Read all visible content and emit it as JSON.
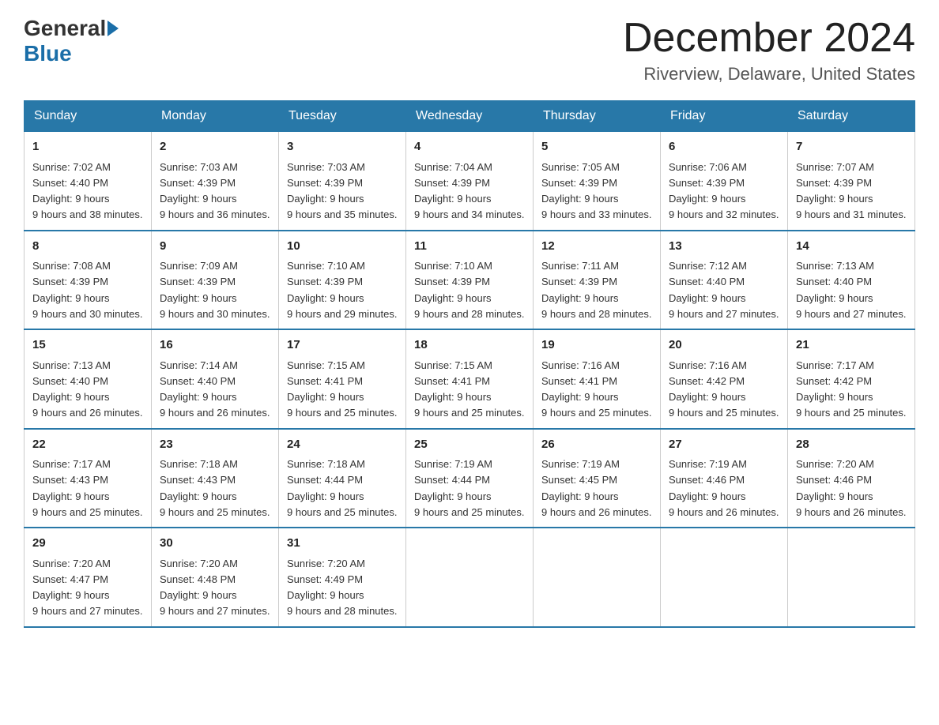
{
  "header": {
    "logo_general": "General",
    "logo_blue": "Blue",
    "month": "December 2024",
    "location": "Riverview, Delaware, United States"
  },
  "weekdays": [
    "Sunday",
    "Monday",
    "Tuesday",
    "Wednesday",
    "Thursday",
    "Friday",
    "Saturday"
  ],
  "weeks": [
    [
      {
        "day": "1",
        "sunrise": "7:02 AM",
        "sunset": "4:40 PM",
        "daylight": "9 hours and 38 minutes."
      },
      {
        "day": "2",
        "sunrise": "7:03 AM",
        "sunset": "4:39 PM",
        "daylight": "9 hours and 36 minutes."
      },
      {
        "day": "3",
        "sunrise": "7:03 AM",
        "sunset": "4:39 PM",
        "daylight": "9 hours and 35 minutes."
      },
      {
        "day": "4",
        "sunrise": "7:04 AM",
        "sunset": "4:39 PM",
        "daylight": "9 hours and 34 minutes."
      },
      {
        "day": "5",
        "sunrise": "7:05 AM",
        "sunset": "4:39 PM",
        "daylight": "9 hours and 33 minutes."
      },
      {
        "day": "6",
        "sunrise": "7:06 AM",
        "sunset": "4:39 PM",
        "daylight": "9 hours and 32 minutes."
      },
      {
        "day": "7",
        "sunrise": "7:07 AM",
        "sunset": "4:39 PM",
        "daylight": "9 hours and 31 minutes."
      }
    ],
    [
      {
        "day": "8",
        "sunrise": "7:08 AM",
        "sunset": "4:39 PM",
        "daylight": "9 hours and 30 minutes."
      },
      {
        "day": "9",
        "sunrise": "7:09 AM",
        "sunset": "4:39 PM",
        "daylight": "9 hours and 30 minutes."
      },
      {
        "day": "10",
        "sunrise": "7:10 AM",
        "sunset": "4:39 PM",
        "daylight": "9 hours and 29 minutes."
      },
      {
        "day": "11",
        "sunrise": "7:10 AM",
        "sunset": "4:39 PM",
        "daylight": "9 hours and 28 minutes."
      },
      {
        "day": "12",
        "sunrise": "7:11 AM",
        "sunset": "4:39 PM",
        "daylight": "9 hours and 28 minutes."
      },
      {
        "day": "13",
        "sunrise": "7:12 AM",
        "sunset": "4:40 PM",
        "daylight": "9 hours and 27 minutes."
      },
      {
        "day": "14",
        "sunrise": "7:13 AM",
        "sunset": "4:40 PM",
        "daylight": "9 hours and 27 minutes."
      }
    ],
    [
      {
        "day": "15",
        "sunrise": "7:13 AM",
        "sunset": "4:40 PM",
        "daylight": "9 hours and 26 minutes."
      },
      {
        "day": "16",
        "sunrise": "7:14 AM",
        "sunset": "4:40 PM",
        "daylight": "9 hours and 26 minutes."
      },
      {
        "day": "17",
        "sunrise": "7:15 AM",
        "sunset": "4:41 PM",
        "daylight": "9 hours and 25 minutes."
      },
      {
        "day": "18",
        "sunrise": "7:15 AM",
        "sunset": "4:41 PM",
        "daylight": "9 hours and 25 minutes."
      },
      {
        "day": "19",
        "sunrise": "7:16 AM",
        "sunset": "4:41 PM",
        "daylight": "9 hours and 25 minutes."
      },
      {
        "day": "20",
        "sunrise": "7:16 AM",
        "sunset": "4:42 PM",
        "daylight": "9 hours and 25 minutes."
      },
      {
        "day": "21",
        "sunrise": "7:17 AM",
        "sunset": "4:42 PM",
        "daylight": "9 hours and 25 minutes."
      }
    ],
    [
      {
        "day": "22",
        "sunrise": "7:17 AM",
        "sunset": "4:43 PM",
        "daylight": "9 hours and 25 minutes."
      },
      {
        "day": "23",
        "sunrise": "7:18 AM",
        "sunset": "4:43 PM",
        "daylight": "9 hours and 25 minutes."
      },
      {
        "day": "24",
        "sunrise": "7:18 AM",
        "sunset": "4:44 PM",
        "daylight": "9 hours and 25 minutes."
      },
      {
        "day": "25",
        "sunrise": "7:19 AM",
        "sunset": "4:44 PM",
        "daylight": "9 hours and 25 minutes."
      },
      {
        "day": "26",
        "sunrise": "7:19 AM",
        "sunset": "4:45 PM",
        "daylight": "9 hours and 26 minutes."
      },
      {
        "day": "27",
        "sunrise": "7:19 AM",
        "sunset": "4:46 PM",
        "daylight": "9 hours and 26 minutes."
      },
      {
        "day": "28",
        "sunrise": "7:20 AM",
        "sunset": "4:46 PM",
        "daylight": "9 hours and 26 minutes."
      }
    ],
    [
      {
        "day": "29",
        "sunrise": "7:20 AM",
        "sunset": "4:47 PM",
        "daylight": "9 hours and 27 minutes."
      },
      {
        "day": "30",
        "sunrise": "7:20 AM",
        "sunset": "4:48 PM",
        "daylight": "9 hours and 27 minutes."
      },
      {
        "day": "31",
        "sunrise": "7:20 AM",
        "sunset": "4:49 PM",
        "daylight": "9 hours and 28 minutes."
      },
      null,
      null,
      null,
      null
    ]
  ]
}
